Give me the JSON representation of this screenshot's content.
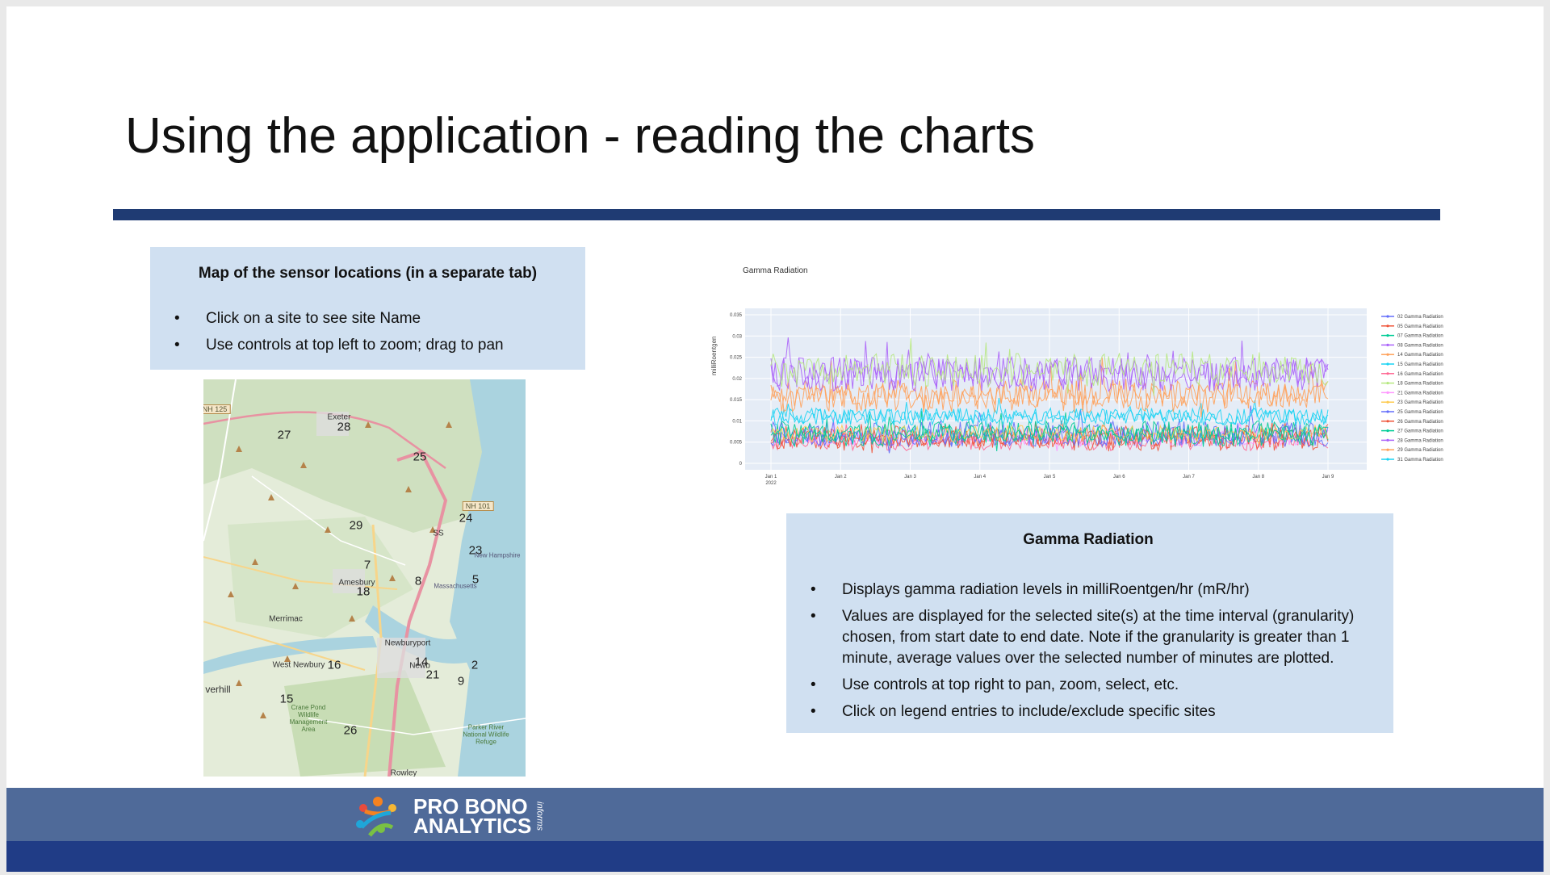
{
  "slide": {
    "title": "Using the application - reading the charts"
  },
  "map_box": {
    "heading": "Map of the sensor locations (in a separate tab)",
    "bullets": [
      "Click on a site to see site Name",
      "Use controls at top left to zoom; drag to pan"
    ]
  },
  "map": {
    "site_numbers": [
      "27",
      "28",
      "25",
      "24",
      "29",
      "23",
      "7",
      "8",
      "5",
      "18",
      "16",
      "14",
      "2",
      "21",
      "9",
      "15",
      "26"
    ],
    "places": [
      "Exeter",
      "Amesbury",
      "Merrimac",
      "West Newbury",
      "Newburyport",
      "Newb",
      "verhill",
      "Rowley",
      "Crane Pond Wildlife Management Area",
      "Parker River National Wildlife Refuge",
      "New Hampshire",
      "Massachusetts",
      "SS"
    ],
    "roads": [
      "NH 125",
      "NH 101"
    ]
  },
  "gamma_box": {
    "heading": "Gamma Radiation",
    "bullets": [
      "Displays gamma radiation levels in milliRoentgen/hr (mR/hr)",
      "Values are displayed for the selected site(s) at the time interval (granularity) chosen, from start date to end date.  Note if the granularity is greater than 1 minute, average values over the selected number of minutes are plotted.",
      "Use controls at top right to pan, zoom, select, etc.",
      "Click on legend entries to include/exclude specific sites"
    ]
  },
  "chart_data": {
    "type": "line",
    "title": "Gamma Radiation",
    "ylabel": "milliRoentgen",
    "xlabel": "",
    "x_ticks": [
      "Jan 1",
      "Jan 2",
      "Jan 3",
      "Jan 4",
      "Jan 5",
      "Jan 6",
      "Jan 7",
      "Jan 8",
      "Jan 9"
    ],
    "x_year": "2022",
    "y_ticks": [
      "0",
      "0.005",
      "0.01",
      "0.015",
      "0.02",
      "0.025",
      "0.03",
      "0.035"
    ],
    "ylim": [
      0,
      0.035
    ],
    "grid": true,
    "legend_position": "right",
    "series": [
      {
        "name": "02 Gamma Radiation",
        "color": "#636efa",
        "mean": 0.007,
        "spread": 0.003
      },
      {
        "name": "05 Gamma Radiation",
        "color": "#ef553b",
        "mean": 0.006,
        "spread": 0.003
      },
      {
        "name": "07 Gamma Radiation",
        "color": "#00cc96",
        "mean": 0.007,
        "spread": 0.003
      },
      {
        "name": "08 Gamma Radiation",
        "color": "#ab63fa",
        "mean": 0.021,
        "spread": 0.004
      },
      {
        "name": "14 Gamma Radiation",
        "color": "#ffa15a",
        "mean": 0.016,
        "spread": 0.004
      },
      {
        "name": "15 Gamma Radiation",
        "color": "#19d3f3",
        "mean": 0.011,
        "spread": 0.002
      },
      {
        "name": "16 Gamma Radiation",
        "color": "#ff6692",
        "mean": 0.005,
        "spread": 0.002
      },
      {
        "name": "18 Gamma Radiation",
        "color": "#b6e880",
        "mean": 0.022,
        "spread": 0.004
      },
      {
        "name": "21 Gamma Radiation",
        "color": "#ff97ff",
        "mean": 0.006,
        "spread": 0.002
      },
      {
        "name": "23 Gamma Radiation",
        "color": "#fecb52",
        "mean": 0.007,
        "spread": 0.002
      },
      {
        "name": "25 Gamma Radiation",
        "color": "#636efa",
        "mean": 0.006,
        "spread": 0.002
      },
      {
        "name": "26 Gamma Radiation",
        "color": "#ef553b",
        "mean": 0.006,
        "spread": 0.002
      },
      {
        "name": "27 Gamma Radiation",
        "color": "#00cc96",
        "mean": 0.007,
        "spread": 0.002
      },
      {
        "name": "28 Gamma Radiation",
        "color": "#ab63fa",
        "mean": 0.021,
        "spread": 0.004
      },
      {
        "name": "29 Gamma Radiation",
        "color": "#ffa15a",
        "mean": 0.016,
        "spread": 0.003
      },
      {
        "name": "31 Gamma Radiation",
        "color": "#19d3f3",
        "mean": 0.011,
        "spread": 0.002
      }
    ]
  },
  "footer": {
    "logo_line1": "PRO BONO",
    "logo_line2": "ANALYTICS",
    "logo_side": "informs",
    "band_color": "#4f6a99",
    "base_color": "#203c86"
  }
}
